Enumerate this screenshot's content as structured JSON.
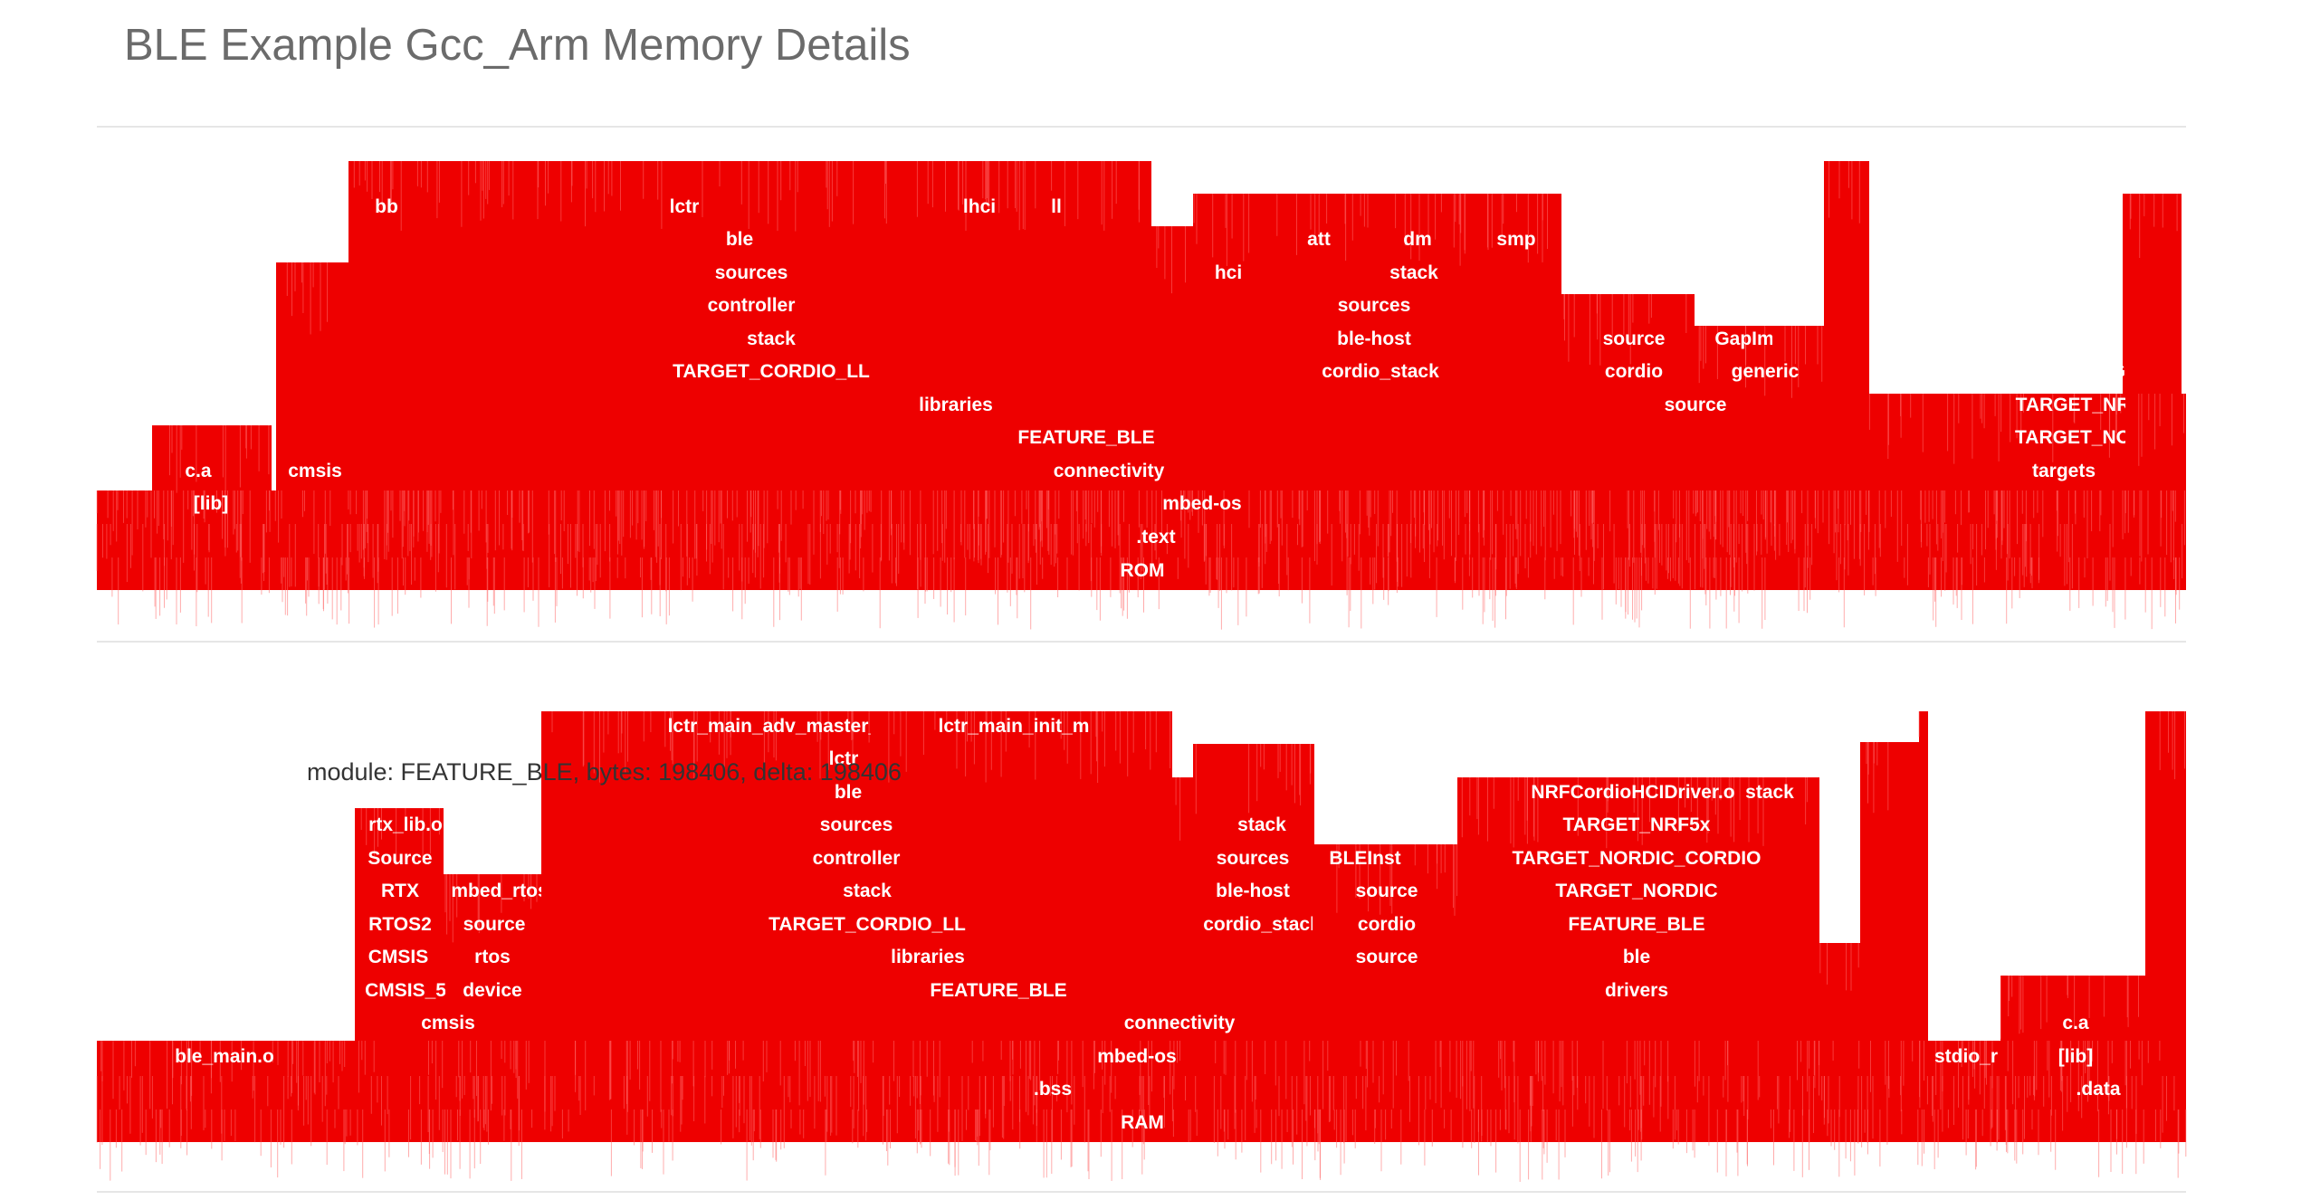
{
  "page": {
    "title": "BLE Example Gcc_Arm Memory Details",
    "tooltip": "module: FEATURE_BLE, bytes: 198406, delta: 198406"
  },
  "colors": {
    "bar": "#ee0000",
    "bar_edge": "#ff6a6a",
    "label": "#ffffff",
    "rule": "#e6e6e6"
  },
  "chart_data": [
    {
      "type": "flame",
      "name": "ROM",
      "levels": [
        {
          "depth": 0,
          "labels": [
            {
              "text": "ROM"
            }
          ]
        },
        {
          "depth": 1,
          "labels": [
            {
              "text": ".text"
            }
          ]
        },
        {
          "depth": 2,
          "labels": [
            {
              "text": "mbed-os"
            },
            {
              "text": "[lib]"
            }
          ]
        },
        {
          "depth": 3,
          "labels": [
            {
              "text": "connectivity"
            },
            {
              "text": "c.a"
            },
            {
              "text": "cmsis"
            },
            {
              "text": "targets"
            }
          ]
        },
        {
          "depth": 4,
          "labels": [
            {
              "text": "FEATURE_BLE"
            },
            {
              "text": "TARGET_NO"
            }
          ]
        },
        {
          "depth": 5,
          "labels": [
            {
              "text": "libraries"
            },
            {
              "text": "source"
            },
            {
              "text": "TARGET_NR"
            }
          ]
        },
        {
          "depth": 6,
          "labels": [
            {
              "text": "TARGET_CORDIO_LL"
            },
            {
              "text": "cordio_stack"
            },
            {
              "text": "cordio"
            },
            {
              "text": "generic"
            },
            {
              "text": "TARGI"
            }
          ]
        },
        {
          "depth": 7,
          "labels": [
            {
              "text": "stack"
            },
            {
              "text": "ble-host"
            },
            {
              "text": "source"
            },
            {
              "text": "GapIm"
            }
          ]
        },
        {
          "depth": 8,
          "labels": [
            {
              "text": "controller"
            },
            {
              "text": "sources"
            }
          ]
        },
        {
          "depth": 9,
          "labels": [
            {
              "text": "sources"
            },
            {
              "text": "hci"
            },
            {
              "text": "stack"
            }
          ]
        },
        {
          "depth": 10,
          "labels": [
            {
              "text": "ble"
            },
            {
              "text": "att"
            },
            {
              "text": "dm"
            },
            {
              "text": "smp"
            }
          ]
        },
        {
          "depth": 11,
          "labels": [
            {
              "text": "bb"
            },
            {
              "text": "lctr"
            },
            {
              "text": "lhci"
            },
            {
              "text": "ll"
            }
          ]
        }
      ]
    },
    {
      "type": "flame",
      "name": "RAM",
      "levels": [
        {
          "depth": 0,
          "labels": [
            {
              "text": "RAM"
            }
          ]
        },
        {
          "depth": 1,
          "labels": [
            {
              "text": ".bss"
            },
            {
              "text": ".data"
            }
          ]
        },
        {
          "depth": 2,
          "labels": [
            {
              "text": "mbed-os"
            },
            {
              "text": "ble_main.o"
            },
            {
              "text": "stdio_r"
            },
            {
              "text": "[lib]"
            }
          ]
        },
        {
          "depth": 3,
          "labels": [
            {
              "text": "connectivity"
            },
            {
              "text": "cmsis"
            },
            {
              "text": "c.a"
            }
          ]
        },
        {
          "depth": 4,
          "labels": [
            {
              "text": "FEATURE_BLE"
            },
            {
              "text": "CMSIS_5"
            },
            {
              "text": "device"
            },
            {
              "text": "drivers"
            }
          ]
        },
        {
          "depth": 5,
          "labels": [
            {
              "text": "libraries"
            },
            {
              "text": "CMSIS"
            },
            {
              "text": "rtos"
            },
            {
              "text": "source"
            },
            {
              "text": "ble"
            }
          ]
        },
        {
          "depth": 6,
          "labels": [
            {
              "text": "TARGET_CORDIO_LL"
            },
            {
              "text": "RTOS2"
            },
            {
              "text": "source"
            },
            {
              "text": "cordio_stack"
            },
            {
              "text": "cordio"
            },
            {
              "text": "FEATURE_BLE"
            }
          ]
        },
        {
          "depth": 7,
          "labels": [
            {
              "text": "stack"
            },
            {
              "text": "RTX"
            },
            {
              "text": "mbed_rtos"
            },
            {
              "text": "ble-host"
            },
            {
              "text": "source"
            },
            {
              "text": "TARGET_NORDIC"
            }
          ]
        },
        {
          "depth": 8,
          "labels": [
            {
              "text": "controller"
            },
            {
              "text": "Source"
            },
            {
              "text": "sources"
            },
            {
              "text": "BLEInst"
            },
            {
              "text": "TARGET_NORDIC_CORDIO"
            }
          ]
        },
        {
          "depth": 9,
          "labels": [
            {
              "text": "sources"
            },
            {
              "text": "rtx_lib.o"
            },
            {
              "text": "stack"
            },
            {
              "text": "TARGET_NRF5x"
            }
          ]
        },
        {
          "depth": 10,
          "labels": [
            {
              "text": "ble"
            },
            {
              "text": "NRFCordioHCIDriver.o"
            },
            {
              "text": "stack"
            }
          ]
        },
        {
          "depth": 11,
          "labels": [
            {
              "text": "lctr"
            },
            {
              "text": "sources"
            }
          ]
        },
        {
          "depth": 12,
          "labels": [
            {
              "text": "lctr_main_adv_master_ae"
            },
            {
              "text": "lctr_main_init_m"
            }
          ]
        }
      ]
    }
  ]
}
